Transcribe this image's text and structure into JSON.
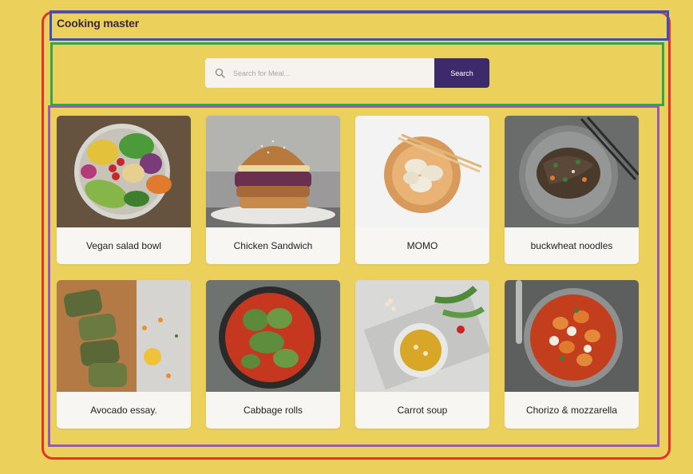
{
  "app": {
    "title": "Cooking master"
  },
  "search": {
    "placeholder": "Search for Meal...",
    "button_label": "Search",
    "icon": "search-icon"
  },
  "meals": [
    {
      "name": "Vegan salad bowl"
    },
    {
      "name": "Chicken Sandwich"
    },
    {
      "name": "MOMO"
    },
    {
      "name": "buckwheat noodles"
    },
    {
      "name": "Avocado essay."
    },
    {
      "name": "Cabbage rolls"
    },
    {
      "name": "Carrot soup"
    },
    {
      "name": "Chorizo & mozzarella"
    }
  ],
  "colors": {
    "background": "#ecd05c",
    "accent": "#3d2a6b",
    "outline_red": "#e5322b",
    "outline_blue": "#3b4fc4",
    "outline_green": "#2fa84a",
    "outline_purple": "#9b59b6"
  }
}
